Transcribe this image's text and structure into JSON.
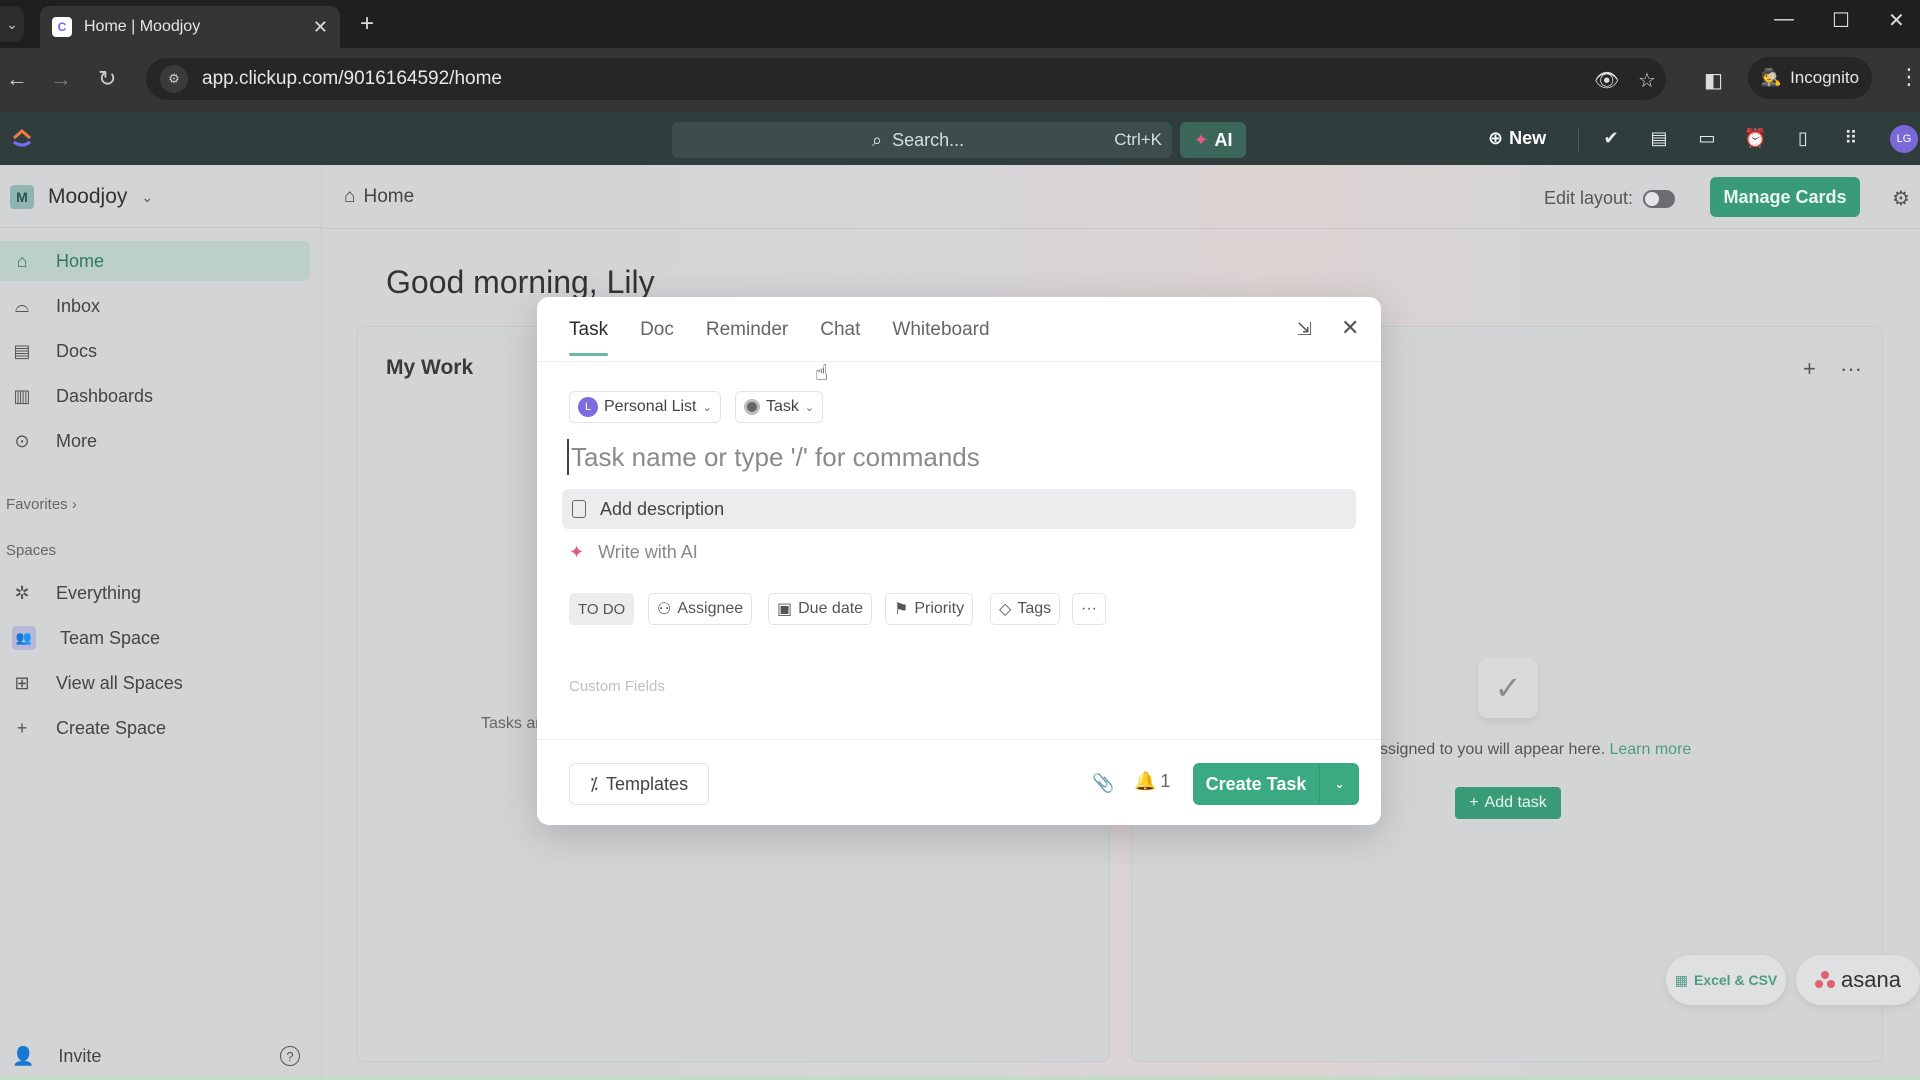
{
  "browser": {
    "tab_title": "Home | Moodjoy",
    "url": "app.clickup.com/9016164592/home",
    "incognito_label": "Incognito",
    "new_tab": "+",
    "tab_close": "✕",
    "window_controls": {
      "minimize": "—",
      "maximize": "☐",
      "close": "✕"
    }
  },
  "appbar": {
    "search_placeholder": "Search...",
    "search_shortcut": "Ctrl+K",
    "ai_label": "AI",
    "new_label": "New",
    "avatar_initials": "LG",
    "icons": [
      "check-circle-icon",
      "notepad-icon",
      "video-icon",
      "alarm-clock-icon",
      "document-icon",
      "apps-grid-icon"
    ]
  },
  "sidebar": {
    "workspace_initial": "M",
    "workspace_name": "Moodjoy",
    "items": [
      {
        "label": "Home",
        "icon": "home-icon",
        "active": true
      },
      {
        "label": "Inbox",
        "icon": "inbox-icon"
      },
      {
        "label": "Docs",
        "icon": "docs-icon"
      },
      {
        "label": "Dashboards",
        "icon": "dashboards-icon"
      },
      {
        "label": "More",
        "icon": "more-icon"
      }
    ],
    "favorites_label": "Favorites",
    "spaces_label": "Spaces",
    "spaces": [
      {
        "label": "Everything",
        "icon": "everything-icon"
      },
      {
        "label": "Team Space",
        "icon": "team-icon"
      },
      {
        "label": "View all Spaces",
        "icon": "grid-icon"
      },
      {
        "label": "Create Space",
        "icon": "plus-icon"
      }
    ],
    "invite_label": "Invite"
  },
  "main": {
    "breadcrumb": "Home",
    "edit_layout_label": "Edit layout:",
    "edit_layout_on": false,
    "manage_cards_label": "Manage Cards",
    "greeting": "Good morning, Lily",
    "my_work_title": "My Work",
    "tasks_text_partial": "Tasks ar",
    "empty_text": "ssigned to you will appear here.",
    "learn_more": "Learn more",
    "add_task_label": "Add task",
    "import_excel": "Excel & CSV",
    "import_asana": "asana"
  },
  "modal": {
    "tabs": [
      "Task",
      "Doc",
      "Reminder",
      "Chat",
      "Whiteboard"
    ],
    "active_tab": "Task",
    "list_chip": {
      "initial": "L",
      "label": "Personal List"
    },
    "type_chip": "Task",
    "task_name_placeholder": "Task name or type '/' for commands",
    "task_name_value": "",
    "description_label": "Add description",
    "write_ai_label": "Write with AI",
    "status_label": "TO DO",
    "properties": [
      "Assignee",
      "Due date",
      "Priority",
      "Tags"
    ],
    "more_label": "···",
    "custom_fields_label": "Custom Fields",
    "templates_label": "Templates",
    "reminder_count": "1",
    "create_label": "Create Task"
  }
}
